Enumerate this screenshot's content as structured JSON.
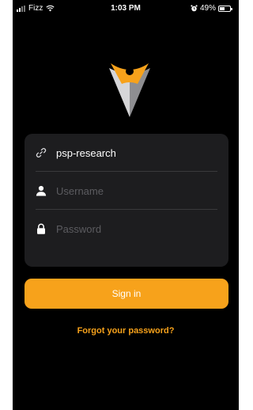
{
  "status_bar": {
    "carrier": "Fizz",
    "time": "1:03 PM",
    "battery_percent": "49%",
    "battery_level": 0.49
  },
  "icons": {
    "logo": "v-shaped-brand-logo",
    "server": "link-icon",
    "username": "person-icon",
    "password": "lock-icon"
  },
  "login_form": {
    "server_value": "psp-research",
    "username_placeholder": "Username",
    "password_placeholder": "Password"
  },
  "actions": {
    "sign_in_label": "Sign in",
    "forgot_password_label": "Forgot your password?"
  },
  "colors": {
    "background": "#000000",
    "card": "#1d1d1f",
    "accent": "#f7a21b",
    "logo_gray": "#b9b9bb"
  }
}
